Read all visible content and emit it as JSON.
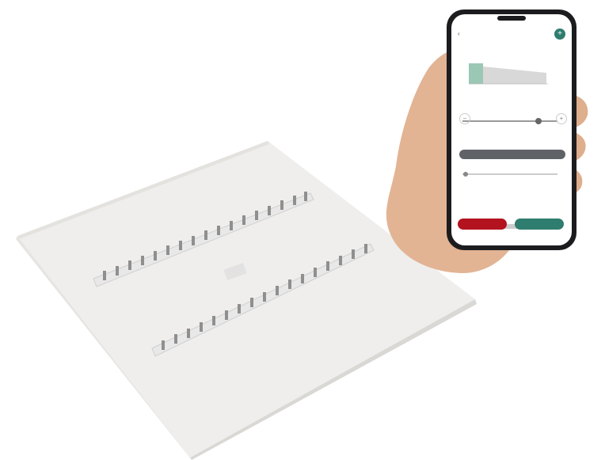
{
  "colors": {
    "panel": "#f2f1ef",
    "led_strip": "#dcdcdc",
    "phone_body": "#1c1c1e",
    "accent_green": "#2f7d6e",
    "accent_red": "#b3121f",
    "skin": "#e2b494"
  },
  "icons": {
    "back": "arrow-left-icon",
    "fab": "plus-icon",
    "minus": "minus-icon",
    "plus": "plus-icon"
  }
}
